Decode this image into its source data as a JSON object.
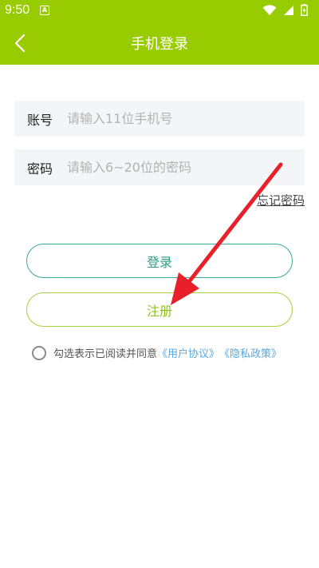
{
  "status_bar": {
    "time": "9:50",
    "notification_letter": "A"
  },
  "header": {
    "title": "手机登录"
  },
  "form": {
    "account": {
      "label": "账号",
      "placeholder": "请输入11位手机号"
    },
    "password": {
      "label": "密码",
      "placeholder": "请输入6~20位的密码"
    },
    "forgot_label": "忘记密码"
  },
  "actions": {
    "login_label": "登录",
    "register_label": "注册"
  },
  "agreement": {
    "text": "勾选表示已阅读并同意",
    "user_agreement": "《用户协议》",
    "privacy_policy": "《隐私政策》"
  },
  "colors": {
    "header_bg": "#99cc00",
    "login_border": "#3aa999",
    "register_border": "#a6d142",
    "link": "#58a8e0",
    "annotation_arrow": "#e8202a"
  },
  "icons": {
    "back": "chevron-left-icon",
    "wifi": "wifi-icon",
    "signal": "signal-icon",
    "battery": "battery-charging-icon",
    "arrow": "annotation-arrow"
  }
}
